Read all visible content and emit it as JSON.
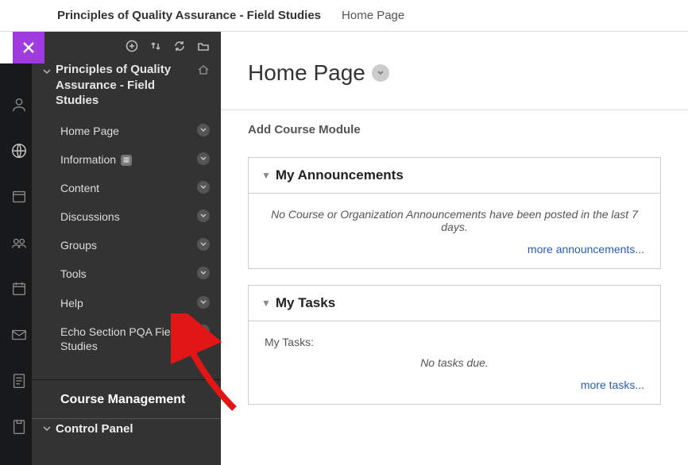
{
  "breadcrumb": {
    "course": "Principles of Quality Assurance - Field Studies",
    "page": "Home Page"
  },
  "sidebar": {
    "course_title": "Principles of Quality Assurance - Field Studies",
    "items": [
      {
        "label": "Home Page",
        "has_chevron": true
      },
      {
        "label": "Information",
        "has_chevron": true,
        "has_badge": true
      },
      {
        "label": "Content",
        "has_chevron": true
      },
      {
        "label": "Discussions",
        "has_chevron": true
      },
      {
        "label": "Groups",
        "has_chevron": true
      },
      {
        "label": "Tools",
        "has_chevron": true
      },
      {
        "label": "Help",
        "has_chevron": true
      },
      {
        "label": "Echo Section PQA Field Studies",
        "has_chevron": true
      }
    ],
    "management_header": "Course Management",
    "control_panel": "Control Panel"
  },
  "main": {
    "page_title": "Home Page",
    "add_module": "Add Course Module",
    "announcements": {
      "title": "My Announcements",
      "empty_text": "No Course or Organization Announcements have been posted in the last 7 days.",
      "more_link": "more announcements..."
    },
    "tasks": {
      "title": "My Tasks",
      "label": "My Tasks:",
      "empty_text": "No tasks due.",
      "more_link": "more tasks..."
    }
  }
}
